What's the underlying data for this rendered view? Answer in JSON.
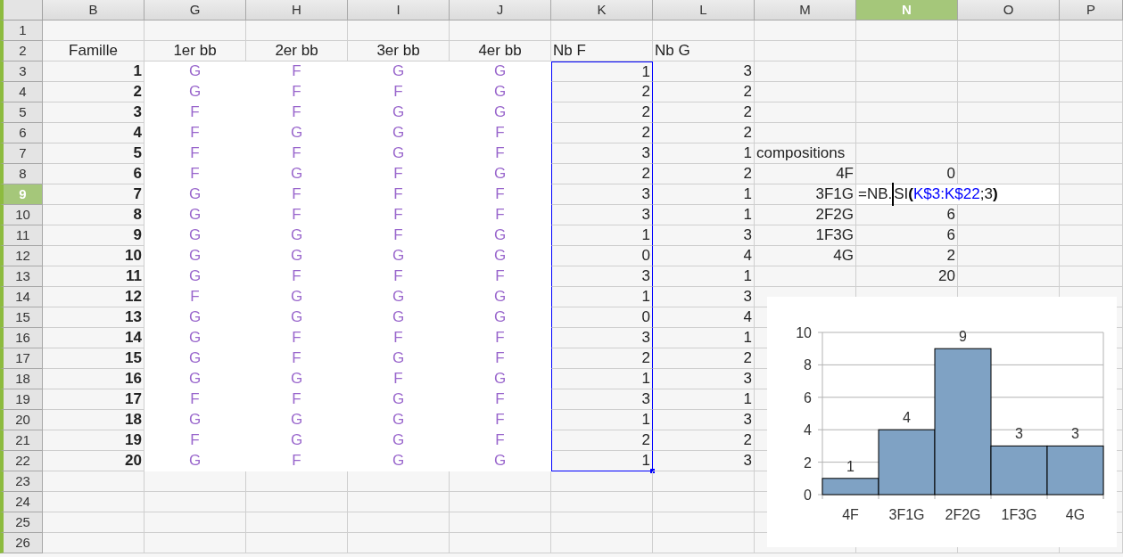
{
  "column_headers": [
    {
      "label": "B",
      "selected": false
    },
    {
      "label": "G",
      "selected": false
    },
    {
      "label": "H",
      "selected": false
    },
    {
      "label": "I",
      "selected": false
    },
    {
      "label": "J",
      "selected": false
    },
    {
      "label": "K",
      "selected": false
    },
    {
      "label": "L",
      "selected": false
    },
    {
      "label": "M",
      "selected": false
    },
    {
      "label": "N",
      "selected": true
    },
    {
      "label": "O",
      "selected": false
    },
    {
      "label": "P",
      "selected": false
    }
  ],
  "row_headers": [
    {
      "label": "1",
      "selected": false
    },
    {
      "label": "2",
      "selected": false
    },
    {
      "label": "3",
      "selected": false
    },
    {
      "label": "4",
      "selected": false
    },
    {
      "label": "5",
      "selected": false
    },
    {
      "label": "6",
      "selected": false
    },
    {
      "label": "7",
      "selected": false
    },
    {
      "label": "8",
      "selected": false
    },
    {
      "label": "9",
      "selected": true
    },
    {
      "label": "10",
      "selected": false
    },
    {
      "label": "11",
      "selected": false
    },
    {
      "label": "12",
      "selected": false
    },
    {
      "label": "13",
      "selected": false
    },
    {
      "label": "14",
      "selected": false
    },
    {
      "label": "15",
      "selected": false
    },
    {
      "label": "16",
      "selected": false
    },
    {
      "label": "17",
      "selected": false
    },
    {
      "label": "18",
      "selected": false
    },
    {
      "label": "19",
      "selected": false
    },
    {
      "label": "20",
      "selected": false
    },
    {
      "label": "21",
      "selected": false
    },
    {
      "label": "22",
      "selected": false
    },
    {
      "label": "23",
      "selected": false
    },
    {
      "label": "24",
      "selected": false
    },
    {
      "label": "25",
      "selected": false
    },
    {
      "label": "26",
      "selected": false
    }
  ],
  "header_row": {
    "family": "Famille",
    "babies": [
      "1er bb",
      "2er bb",
      "3er bb",
      "4er bb"
    ],
    "nb_f": "Nb F",
    "nb_g": "Nb G"
  },
  "families": [
    {
      "number": "1",
      "babies": [
        "G",
        "F",
        "G",
        "G"
      ],
      "nb_f": "1",
      "nb_g": "3",
      "nb_f_highlighted": true
    },
    {
      "number": "2",
      "babies": [
        "G",
        "F",
        "F",
        "G"
      ],
      "nb_f": "2",
      "nb_g": "2",
      "nb_f_highlighted": true
    },
    {
      "number": "3",
      "babies": [
        "F",
        "F",
        "G",
        "G"
      ],
      "nb_f": "2",
      "nb_g": "2",
      "nb_f_highlighted": true
    },
    {
      "number": "4",
      "babies": [
        "F",
        "G",
        "G",
        "F"
      ],
      "nb_f": "2",
      "nb_g": "2",
      "nb_f_highlighted": true
    },
    {
      "number": "5",
      "babies": [
        "F",
        "F",
        "G",
        "F"
      ],
      "nb_f": "3",
      "nb_g": "1",
      "nb_f_highlighted": true
    },
    {
      "number": "6",
      "babies": [
        "F",
        "G",
        "F",
        "G"
      ],
      "nb_f": "2",
      "nb_g": "2",
      "nb_f_highlighted": true
    },
    {
      "number": "7",
      "babies": [
        "G",
        "F",
        "F",
        "F"
      ],
      "nb_f": "3",
      "nb_g": "1",
      "nb_f_highlighted": true
    },
    {
      "number": "8",
      "babies": [
        "G",
        "F",
        "F",
        "F"
      ],
      "nb_f": "3",
      "nb_g": "1",
      "nb_f_highlighted": true
    },
    {
      "number": "9",
      "babies": [
        "G",
        "G",
        "F",
        "G"
      ],
      "nb_f": "1",
      "nb_g": "3",
      "nb_f_highlighted": true
    },
    {
      "number": "10",
      "babies": [
        "G",
        "G",
        "G",
        "G"
      ],
      "nb_f": "0",
      "nb_g": "4",
      "nb_f_highlighted": true
    },
    {
      "number": "11",
      "babies": [
        "G",
        "F",
        "F",
        "F"
      ],
      "nb_f": "3",
      "nb_g": "1",
      "nb_f_highlighted": true
    },
    {
      "number": "12",
      "babies": [
        "F",
        "G",
        "G",
        "G"
      ],
      "nb_f": "1",
      "nb_g": "3",
      "nb_f_highlighted": true
    },
    {
      "number": "13",
      "babies": [
        "G",
        "G",
        "G",
        "G"
      ],
      "nb_f": "0",
      "nb_g": "4",
      "nb_f_highlighted": true
    },
    {
      "number": "14",
      "babies": [
        "G",
        "F",
        "F",
        "F"
      ],
      "nb_f": "3",
      "nb_g": "1",
      "nb_f_highlighted": true
    },
    {
      "number": "15",
      "babies": [
        "G",
        "F",
        "G",
        "F"
      ],
      "nb_f": "2",
      "nb_g": "2",
      "nb_f_highlighted": true
    },
    {
      "number": "16",
      "babies": [
        "G",
        "G",
        "F",
        "G"
      ],
      "nb_f": "1",
      "nb_g": "3",
      "nb_f_highlighted": true
    },
    {
      "number": "17",
      "babies": [
        "F",
        "F",
        "G",
        "F"
      ],
      "nb_f": "3",
      "nb_g": "1",
      "nb_f_highlighted": true
    },
    {
      "number": "18",
      "babies": [
        "G",
        "G",
        "G",
        "F"
      ],
      "nb_f": "1",
      "nb_g": "3",
      "nb_f_highlighted": true
    },
    {
      "number": "19",
      "babies": [
        "F",
        "G",
        "G",
        "F"
      ],
      "nb_f": "2",
      "nb_g": "2",
      "nb_f_highlighted": true
    },
    {
      "number": "20",
      "babies": [
        "G",
        "F",
        "G",
        "G"
      ],
      "nb_f": "1",
      "nb_g": "3",
      "nb_f_highlighted": true
    }
  ],
  "compositions": {
    "title": "compositions",
    "items": [
      {
        "label": "4F",
        "kind": "value",
        "value": "0"
      },
      {
        "label": "3F1G",
        "kind": "formula",
        "parts": [
          {
            "text": "=NB.",
            "kind": "plain",
            "caret_before": false
          },
          {
            "text": "SI",
            "kind": "plain",
            "caret_before": true
          },
          {
            "text": "(",
            "kind": "paren",
            "caret_before": false
          },
          {
            "text": "K$3:K$22",
            "kind": "ref",
            "caret_before": false
          },
          {
            "text": ";3",
            "kind": "plain",
            "caret_before": false
          },
          {
            "text": ")",
            "kind": "paren",
            "caret_before": false
          }
        ]
      },
      {
        "label": "2F2G",
        "kind": "value",
        "value": "6"
      },
      {
        "label": "1F3G",
        "kind": "value",
        "value": "6"
      },
      {
        "label": "4G",
        "kind": "value",
        "value": "2"
      }
    ],
    "total": "20"
  },
  "chart": {
    "chart_data": {
      "type": "bar",
      "categories": [
        "4F",
        "3F1G",
        "2F2G",
        "1F3G",
        "4G"
      ],
      "series": [
        {
          "color": "#7fa2c4",
          "values": [
            1,
            4,
            9,
            3,
            3
          ]
        }
      ],
      "ylim": [
        0,
        10
      ],
      "grid": true,
      "yticks": [
        0,
        2,
        4,
        6,
        8,
        10
      ],
      "data_labels": true
    }
  }
}
